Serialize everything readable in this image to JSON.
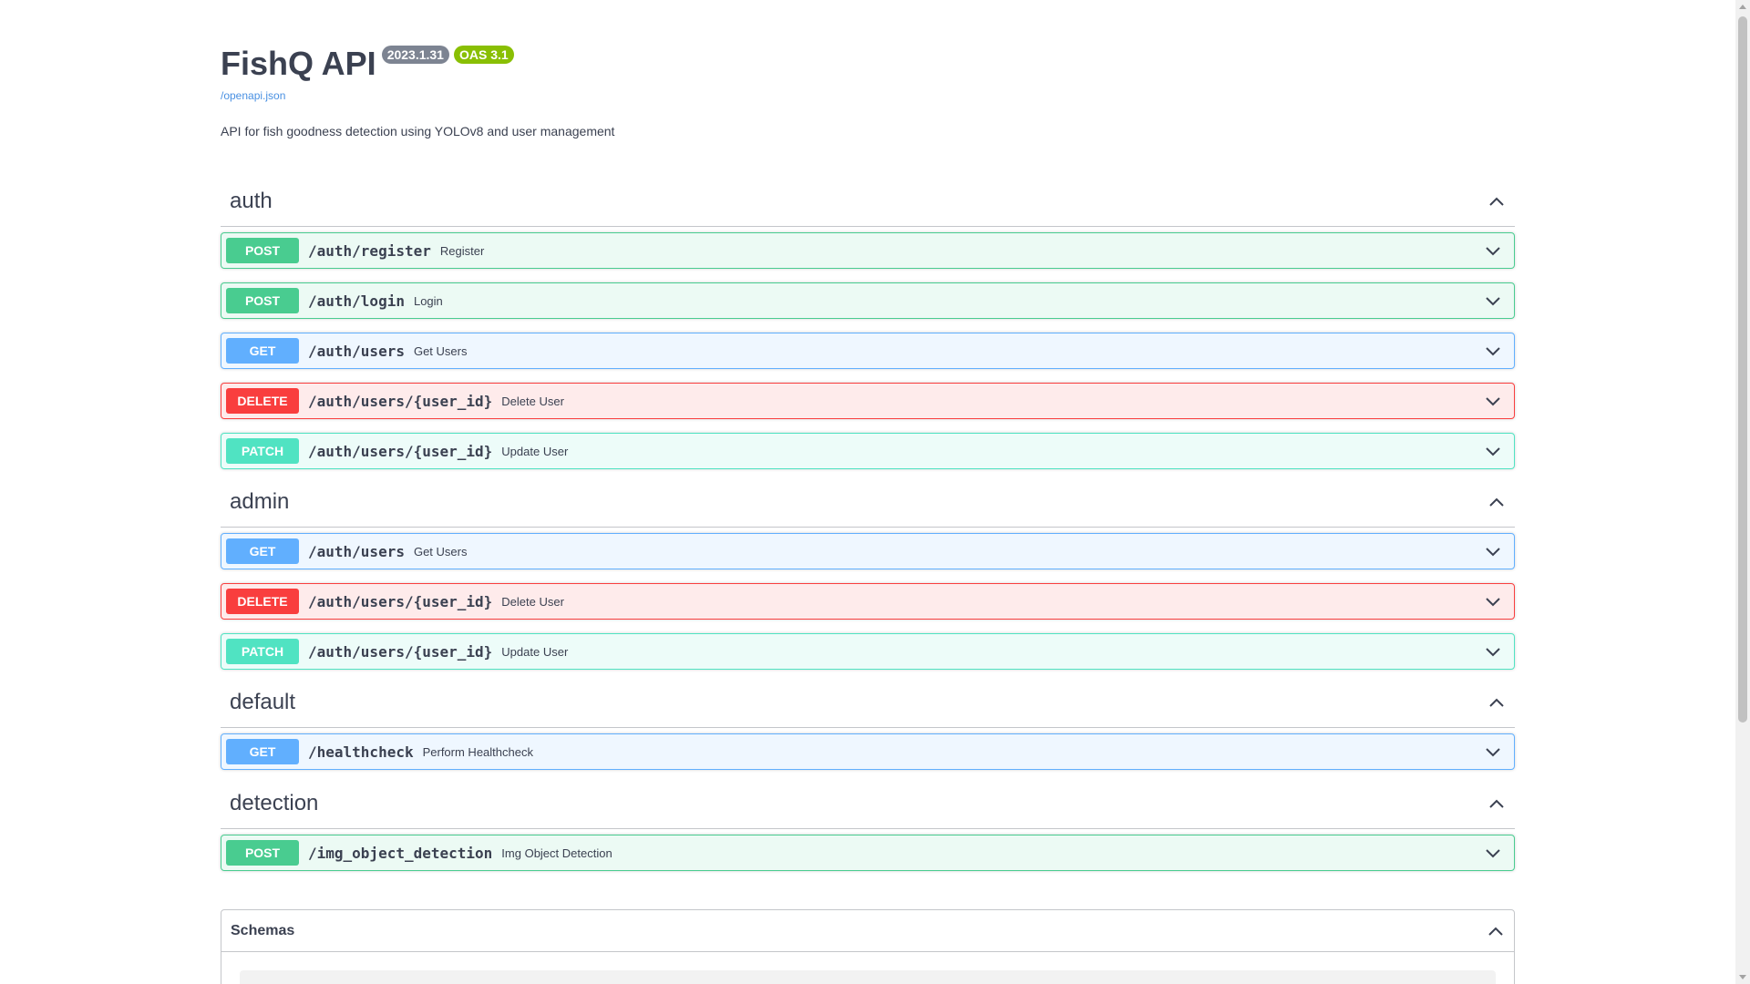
{
  "info": {
    "title": "FishQ API",
    "version": "2023.1.31",
    "oas": "OAS 3.1",
    "spec_link": "/openapi.json",
    "description": "API for fish goodness detection using YOLOv8 and user management"
  },
  "tags": [
    {
      "name": "auth",
      "ops": [
        {
          "method": "POST",
          "path": "/auth/register",
          "summary": "Register"
        },
        {
          "method": "POST",
          "path": "/auth/login",
          "summary": "Login"
        },
        {
          "method": "GET",
          "path": "/auth/users",
          "summary": "Get Users"
        },
        {
          "method": "DELETE",
          "path": "/auth/users/{user_id}",
          "summary": "Delete User"
        },
        {
          "method": "PATCH",
          "path": "/auth/users/{user_id}",
          "summary": "Update User"
        }
      ]
    },
    {
      "name": "admin",
      "ops": [
        {
          "method": "GET",
          "path": "/auth/users",
          "summary": "Get Users"
        },
        {
          "method": "DELETE",
          "path": "/auth/users/{user_id}",
          "summary": "Delete User"
        },
        {
          "method": "PATCH",
          "path": "/auth/users/{user_id}",
          "summary": "Update User"
        }
      ]
    },
    {
      "name": "default",
      "ops": [
        {
          "method": "GET",
          "path": "/healthcheck",
          "summary": "Perform Healthcheck"
        }
      ]
    },
    {
      "name": "detection",
      "ops": [
        {
          "method": "POST",
          "path": "/img_object_detection",
          "summary": "Img Object Detection"
        }
      ]
    }
  ],
  "schemas": {
    "title": "Schemas"
  },
  "icons": {
    "collapse": "chevron-up-icon",
    "expand": "chevron-down-icon"
  },
  "colors": {
    "post": "#49cc90",
    "get": "#61affe",
    "delete": "#f93e3e",
    "patch": "#50e3c2",
    "version_badge": "#7d8492",
    "oas_badge": "#89bf04",
    "link": "#4990e2"
  }
}
